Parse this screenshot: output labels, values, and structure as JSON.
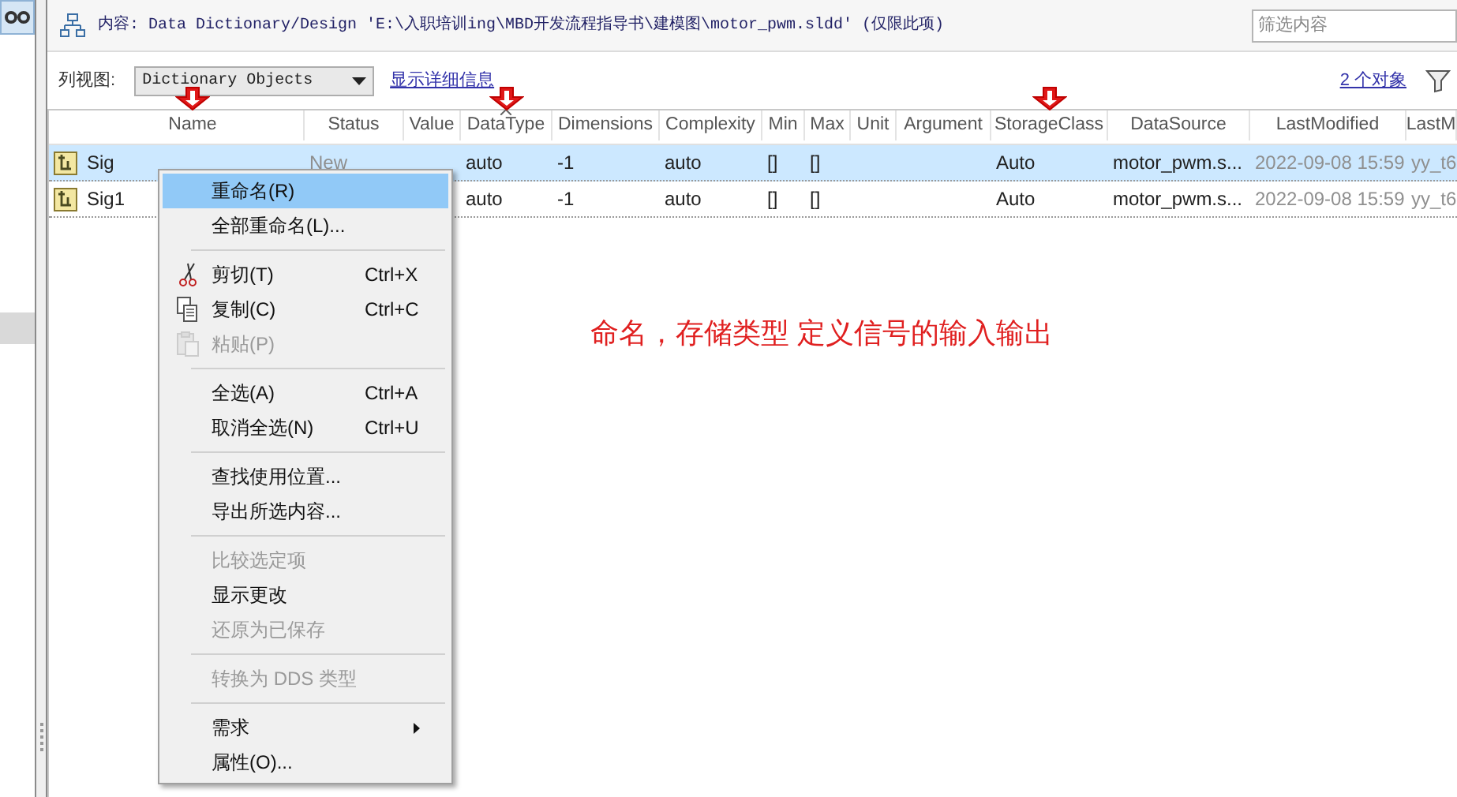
{
  "header": {
    "content_path": "内容: Data Dictionary/Design 'E:\\入职培训ing\\MBD开发流程指导书\\建模图\\motor_pwm.sldd' (仅限此项)",
    "filter": {
      "placeholder": "筛选内容"
    }
  },
  "toolbar": {
    "view_label": "列视图:",
    "view_value": "Dictionary Objects",
    "details_link": "显示详细信息",
    "count_link": "2 个对象"
  },
  "table": {
    "columns": [
      {
        "label": "Name",
        "marked": true,
        "sorted": false
      },
      {
        "label": "Status",
        "marked": false,
        "sorted": false
      },
      {
        "label": "Value",
        "marked": false,
        "sorted": false
      },
      {
        "label": "DataType",
        "marked": true,
        "sorted": true
      },
      {
        "label": "Dimensions",
        "marked": false,
        "sorted": false
      },
      {
        "label": "Complexity",
        "marked": false,
        "sorted": false
      },
      {
        "label": "Min",
        "marked": false,
        "sorted": false
      },
      {
        "label": "Max",
        "marked": false,
        "sorted": false
      },
      {
        "label": "Unit",
        "marked": false,
        "sorted": false
      },
      {
        "label": "Argument",
        "marked": false,
        "sorted": false
      },
      {
        "label": "StorageClass",
        "marked": true,
        "sorted": false
      },
      {
        "label": "DataSource",
        "marked": false,
        "sorted": false
      },
      {
        "label": "LastModified",
        "marked": false,
        "sorted": false
      },
      {
        "label": "LastM",
        "marked": false,
        "sorted": false
      }
    ],
    "rows": [
      {
        "selected": true,
        "cells": [
          {
            "text": "Sig",
            "muted": false
          },
          {
            "text": "New",
            "muted": true
          },
          null,
          {
            "text": "auto",
            "muted": false
          },
          {
            "text": "-1",
            "muted": false
          },
          {
            "text": "auto",
            "muted": false
          },
          {
            "text": "[]",
            "muted": false
          },
          {
            "text": "[]",
            "muted": false
          },
          null,
          null,
          {
            "text": "Auto",
            "muted": false
          },
          {
            "text": "motor_pwm.s...",
            "muted": false
          },
          {
            "text": "2022-09-08 15:59",
            "muted": true
          },
          {
            "text": "yy_t6",
            "muted": true
          }
        ]
      },
      {
        "selected": false,
        "cells": [
          {
            "text": "Sig1",
            "muted": false
          },
          null,
          null,
          {
            "text": "auto",
            "muted": false
          },
          {
            "text": "-1",
            "muted": false
          },
          {
            "text": "auto",
            "muted": false
          },
          {
            "text": "[]",
            "muted": false
          },
          {
            "text": "[]",
            "muted": false
          },
          null,
          null,
          {
            "text": "Auto",
            "muted": false
          },
          {
            "text": "motor_pwm.s...",
            "muted": false
          },
          {
            "text": "2022-09-08 15:59",
            "muted": true
          },
          {
            "text": "yy_t6",
            "muted": true
          }
        ]
      }
    ]
  },
  "annotation": "命名，存储类型  定义信号的输入输出",
  "context_menu": [
    {
      "kind": "item",
      "label": "重命名(R)",
      "selected": true,
      "disabled": false
    },
    {
      "kind": "item",
      "label": "全部重命名(L)...",
      "selected": false,
      "disabled": false
    },
    {
      "kind": "separator"
    },
    {
      "kind": "icon_item",
      "label": "剪切(T)",
      "shortcut": "Ctrl+X",
      "selected": false,
      "disabled": false
    },
    {
      "kind": "icon_item",
      "label": "复制(C)",
      "shortcut": "Ctrl+C",
      "selected": false,
      "disabled": false
    },
    {
      "kind": "icon_item",
      "label": "粘贴(P)",
      "selected": false,
      "disabled": true
    },
    {
      "kind": "separator"
    },
    {
      "kind": "item",
      "label": "全选(A)",
      "shortcut": "Ctrl+A",
      "selected": false,
      "disabled": false
    },
    {
      "kind": "item",
      "label": "取消全选(N)",
      "shortcut": "Ctrl+U",
      "selected": false,
      "disabled": false
    },
    {
      "kind": "separator"
    },
    {
      "kind": "item",
      "label": "查找使用位置...",
      "selected": false,
      "disabled": false
    },
    {
      "kind": "item",
      "label": "导出所选内容...",
      "selected": false,
      "disabled": false
    },
    {
      "kind": "separator"
    },
    {
      "kind": "item",
      "label": "比较选定项",
      "selected": false,
      "disabled": true
    },
    {
      "kind": "item",
      "label": "显示更改",
      "selected": false,
      "disabled": false
    },
    {
      "kind": "item",
      "label": "还原为已保存",
      "selected": false,
      "disabled": true
    },
    {
      "kind": "separator"
    },
    {
      "kind": "item",
      "label": "转换为 DDS 类型",
      "selected": false,
      "disabled": true
    },
    {
      "kind": "separator"
    },
    {
      "kind": "item",
      "label": "需求",
      "submenu": true,
      "selected": false,
      "disabled": false
    },
    {
      "kind": "item",
      "label": "属性(O)...",
      "selected": false,
      "disabled": false
    }
  ]
}
